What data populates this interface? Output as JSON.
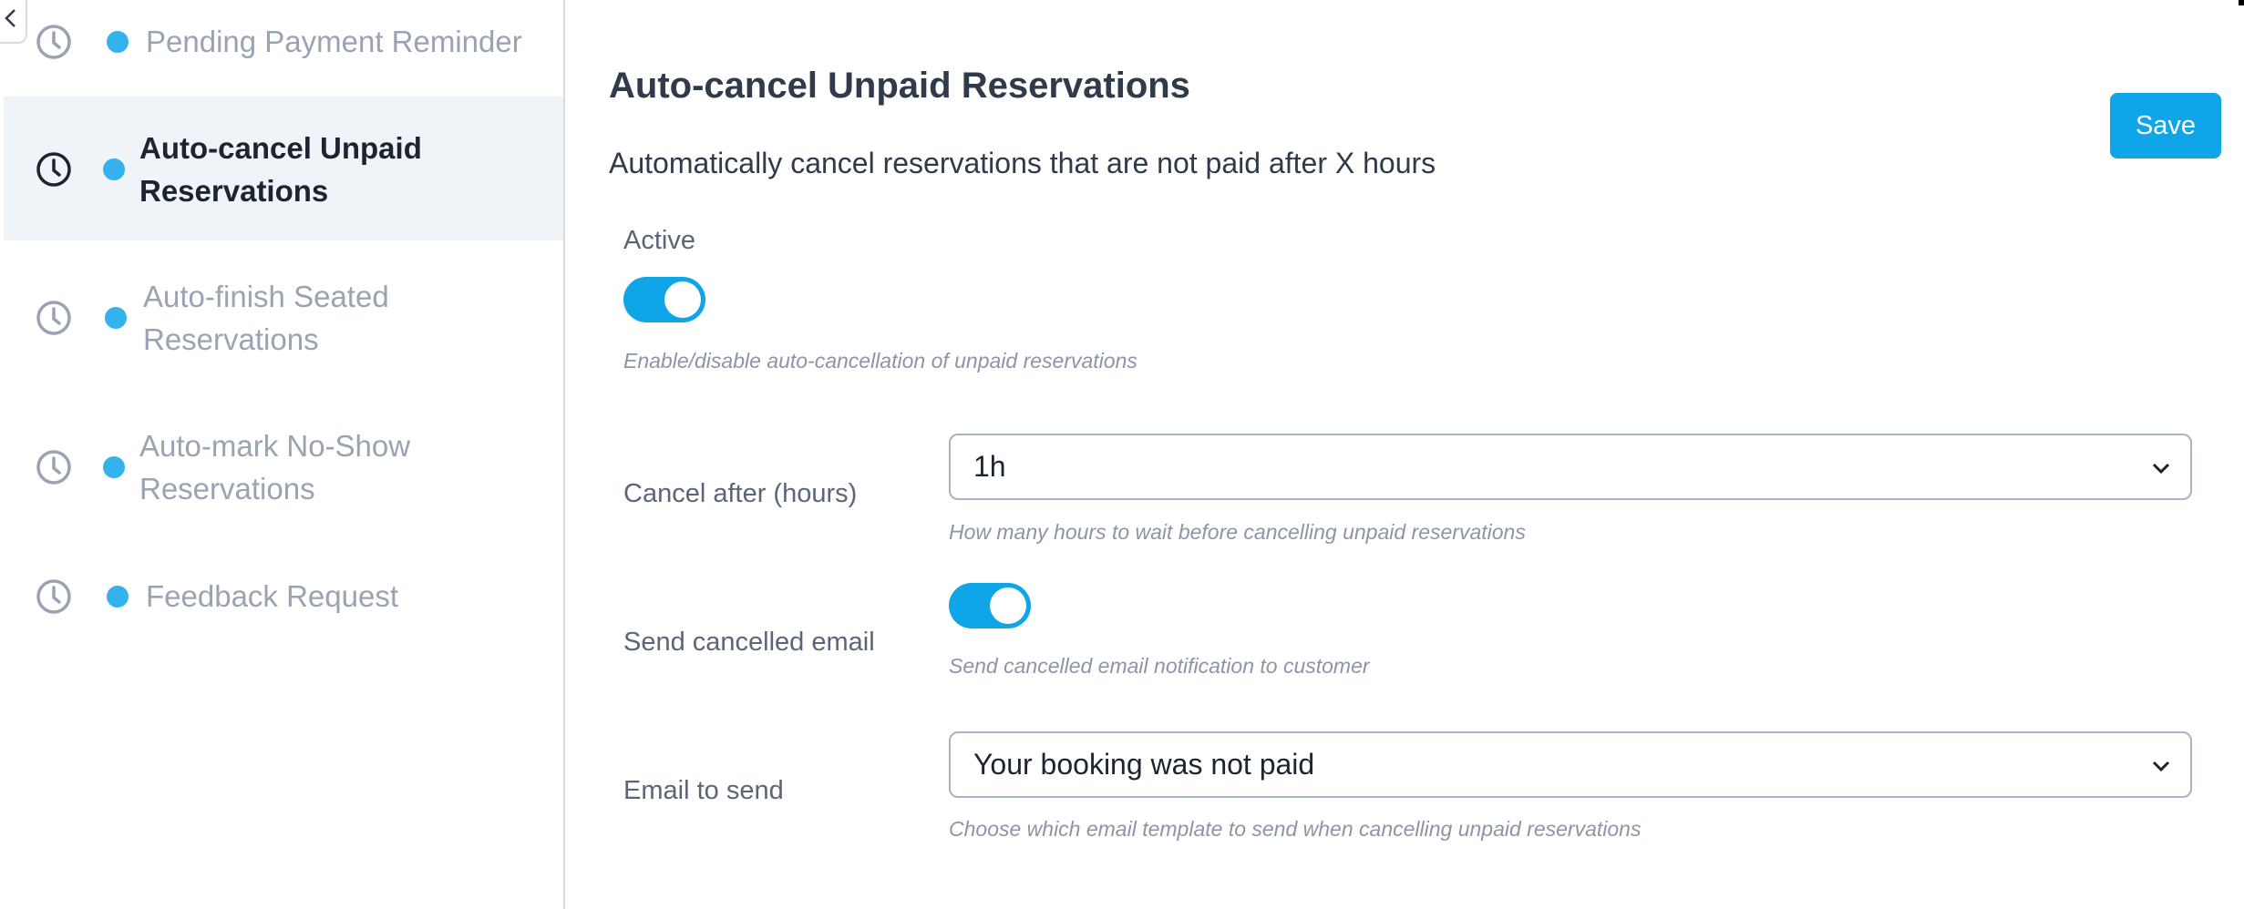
{
  "sidebar": {
    "items": [
      {
        "label": "Pending Payment Reminder",
        "active": false
      },
      {
        "label": "Auto-cancel Unpaid Reservations",
        "active": true
      },
      {
        "label": "Auto-finish Seated Reservations",
        "active": false
      },
      {
        "label": "Auto-mark No-Show Reservations",
        "active": false
      },
      {
        "label": "Feedback Request",
        "active": false
      }
    ]
  },
  "main": {
    "title": "Auto-cancel Unpaid Reservations",
    "description": "Automatically cancel reservations that are not paid after X hours",
    "save_label": "Save",
    "active": {
      "label": "Active",
      "enabled": true,
      "hint": "Enable/disable auto-cancellation of unpaid reservations"
    },
    "cancel_after": {
      "label": "Cancel after (hours)",
      "value": "1h",
      "hint": "How many hours to wait before cancelling unpaid reservations"
    },
    "send_email": {
      "label": "Send cancelled email",
      "enabled": true,
      "hint": "Send cancelled email notification to customer"
    },
    "email_to_send": {
      "label": "Email to send",
      "value": "Your booking was not paid",
      "hint": "Choose which email template to send when cancelling unpaid reservations"
    }
  },
  "colors": {
    "accent": "#0ea5e9",
    "dot": "#33b2ee",
    "active_bg": "#f0f4f8",
    "muted_text": "#9aa3b2"
  },
  "icons": [
    "chevron-left-icon",
    "clock-icon",
    "chevron-down-icon"
  ]
}
